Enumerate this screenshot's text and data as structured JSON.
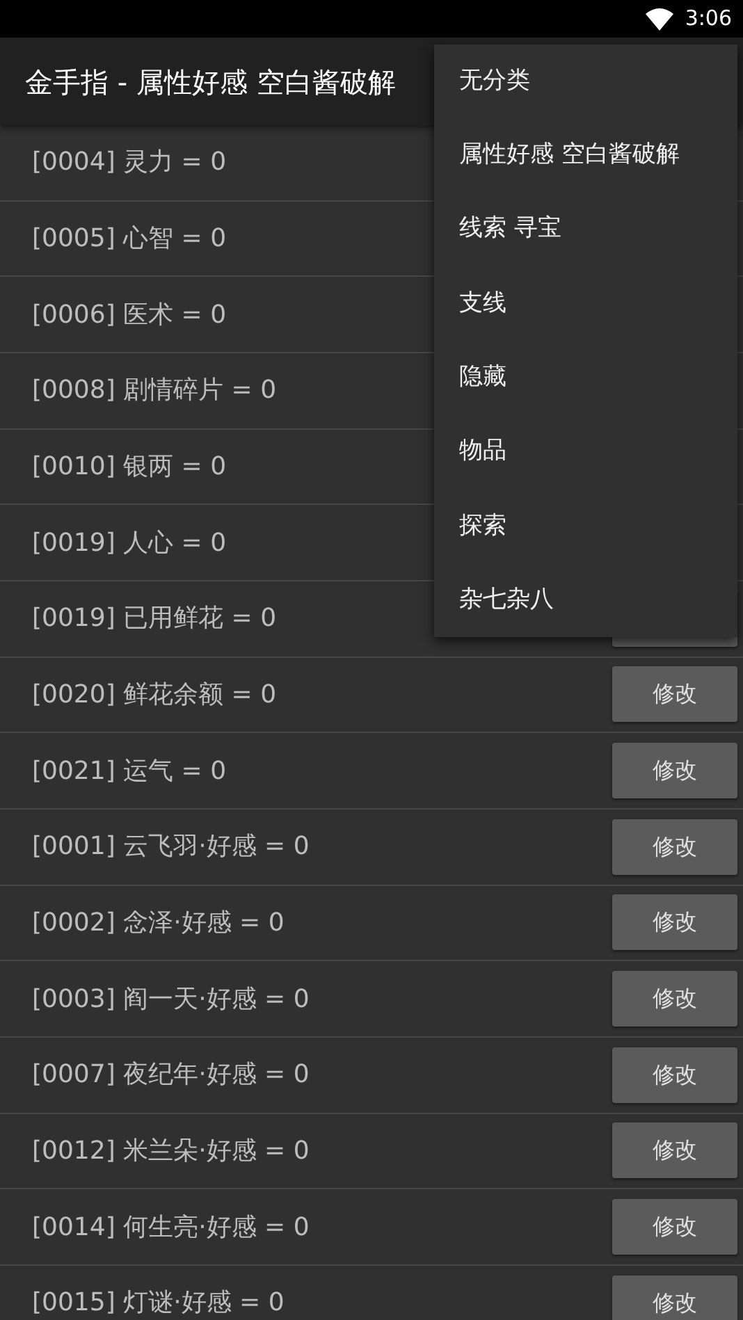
{
  "status_bar": {
    "time": "3:06"
  },
  "app_bar": {
    "title": "金手指 - 属性好感 空白酱破解"
  },
  "rows": [
    {
      "text": "[0004] 灵力 = 0"
    },
    {
      "text": "[0005] 心智 = 0"
    },
    {
      "text": "[0006] 医术 = 0"
    },
    {
      "text": "[0008] 剧情碎片 = 0"
    },
    {
      "text": "[0010] 银两 = 0"
    },
    {
      "text": "[0019] 人心 = 0"
    },
    {
      "text": "[0019] 已用鲜花 = 0",
      "button_covered": true
    },
    {
      "text": "[0020] 鲜花余额 = 0",
      "button": "修改"
    },
    {
      "text": "[0021] 运气 = 0",
      "button": "修改"
    },
    {
      "text": "[0001] 云飞羽·好感 = 0",
      "button": "修改"
    },
    {
      "text": "[0002] 念泽·好感 = 0",
      "button": "修改"
    },
    {
      "text": "[0003] 阎一天·好感 = 0",
      "button": "修改"
    },
    {
      "text": "[0007] 夜纪年·好感 = 0",
      "button": "修改"
    },
    {
      "text": "[0012] 米兰朵·好感 = 0",
      "button": "修改"
    },
    {
      "text": "[0014] 何生亮·好感 = 0",
      "button": "修改"
    },
    {
      "text": "[0015] 灯谜·好感 = 0",
      "button": "修改"
    }
  ],
  "menu": {
    "items": [
      "无分类",
      "属性好感 空白酱破解",
      "线索 寻宝",
      "支线",
      "隐藏",
      "物品",
      "探索",
      "杂七杂八"
    ]
  }
}
